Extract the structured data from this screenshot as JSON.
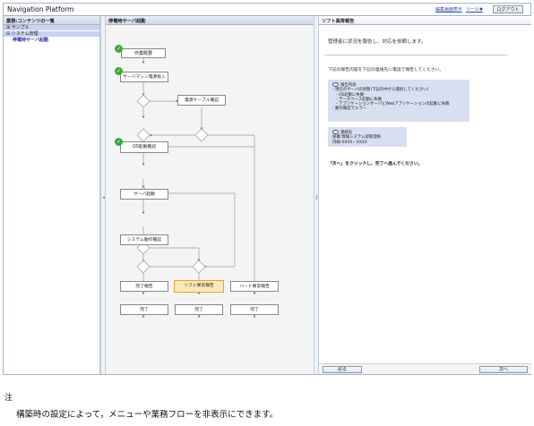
{
  "app": {
    "title": "Navigation Platform"
  },
  "toolbar": {
    "edit_view": "編集画面表示",
    "tools": "ツール▼",
    "logout": "ログアウト"
  },
  "left_pane": {
    "header": "業務:コンテンツの一覧",
    "items": [
      {
        "label": "⊞ サンプル"
      },
      {
        "label": "⊟ システム管理"
      },
      {
        "label": "停電時サーバ起動"
      }
    ]
  },
  "splitter": {
    "left_arrow": "◂",
    "right_arrow": "‖"
  },
  "flow": {
    "header": "停電時サーバ起動",
    "nodes": {
      "work_overview": "作業概要",
      "power_on": "サーバマシン電源投入",
      "power_cable": "電源ケーブル確認",
      "os_boot": "OS起動確認",
      "server_start": "サーバ起動",
      "system_check": "システム動作確認",
      "report_complete": "完了報告",
      "report_soft": "ソフト異常報告",
      "report_hard": "ハード異常報告",
      "done1": "完了",
      "done2": "完了",
      "done3": "完了"
    },
    "colors": {
      "active_fill": "#fde9b8",
      "active_border": "#e8a126",
      "check": "#3aa93a"
    }
  },
  "right_pane": {
    "header": "ソフト異常報告",
    "lead": "管理者に状況を報告し、対応を依頼します。",
    "instruction": "下記の報告内容を下記の連絡先に電話で報告してください。",
    "report_box": {
      "title": "報告内容",
      "lines": [
        "- 現在のサーバの状態(下記の中から選択してください)",
        "  - OS起動に失敗",
        "  - データベース起動に失敗",
        "  - アプリケーションサーバとWebアプリケーションの起動に失敗",
        "- 動作確認でエラー"
      ]
    },
    "contact_box": {
      "title": "連絡先",
      "lines": [
        "部署:情報システム部管理係",
        "内線:XXXX－XXXX"
      ]
    },
    "final": "「次へ」をクリックし、完了へ進んでください。",
    "back_button": "戻る",
    "next_button": "次へ"
  },
  "note": {
    "label": "注",
    "text": "構築時の設定によって，メニューや業務フローを非表示にできます。"
  }
}
